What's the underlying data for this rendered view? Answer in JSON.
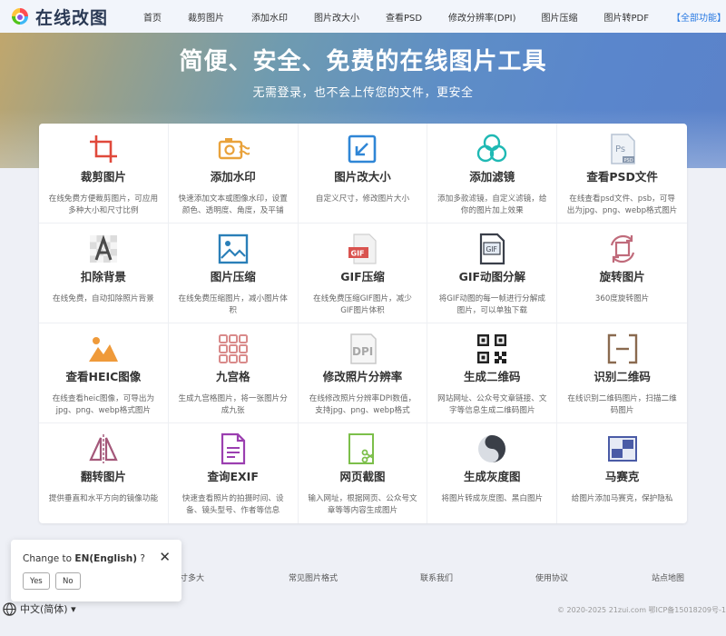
{
  "logo": {
    "text": "在线改图",
    "mark": "rainbow-logo-icon"
  },
  "nav": {
    "items": [
      "首页",
      "裁剪图片",
      "添加水印",
      "图片改大小",
      "查看PSD",
      "修改分辨率(DPI)",
      "图片压缩",
      "图片转PDF",
      "【全部功能】"
    ],
    "accent_color": "#2a7ae2"
  },
  "hero": {
    "title": "简便、安全、免费的在线图片工具",
    "subtitle": "无需登录，也不会上传您的文件，更安全"
  },
  "tools": [
    {
      "name": "裁剪图片",
      "desc": "在线免费方便裁剪图片，可应用多种大小和尺寸比例",
      "icon": "crop-icon"
    },
    {
      "name": "添加水印",
      "desc": "快速添加文本或图像水印，设置颜色、透明度、角度，及平铺",
      "icon": "watermark-icon"
    },
    {
      "name": "图片改大小",
      "desc": "自定义尺寸，修改图片大小",
      "icon": "resize-icon"
    },
    {
      "name": "添加滤镜",
      "desc": "添加多款滤镜，自定义滤镜，给你的图片加上效果",
      "icon": "filter-icon"
    },
    {
      "name": "查看PSD文件",
      "desc": "在线查看psd文件、psb，可导出为jpg、png、webp格式图片",
      "icon": "psd-icon"
    },
    {
      "name": "扣除背景",
      "desc": "在线免费，自动扣除照片背景",
      "icon": "remove-background-icon"
    },
    {
      "name": "图片压缩",
      "desc": "在线免费压缩图片，减小图片体积",
      "icon": "image-compress-icon"
    },
    {
      "name": "GIF压缩",
      "desc": "在线免费压缩GIF图片，减少GIF图片体积",
      "icon": "gif-compress-icon"
    },
    {
      "name": "GIF动图分解",
      "desc": "将GIF动图的每一帧进行分解成图片，可以单独下载",
      "icon": "gif-split-icon"
    },
    {
      "name": "旋转图片",
      "desc": "360度旋转图片",
      "icon": "rotate-icon"
    },
    {
      "name": "查看HEIC图像",
      "desc": "在线查看heic图像，可导出为jpg、png、webp格式图片",
      "icon": "heic-icon"
    },
    {
      "name": "九宫格",
      "desc": "生成九宫格图片，将一张图片分成九张",
      "icon": "nine-grid-icon"
    },
    {
      "name": "修改照片分辨率",
      "desc": "在线修改照片分辨率DPI数值，支持jpg、png、webp格式",
      "icon": "dpi-icon"
    },
    {
      "name": "生成二维码",
      "desc": "网站网址、公众号文章链接、文字等信息生成二维码图片",
      "icon": "qrcode-icon"
    },
    {
      "name": "识别二维码",
      "desc": "在线识别二维码图片，扫描二维码图片",
      "icon": "qr-scan-icon"
    },
    {
      "name": "翻转图片",
      "desc": "提供垂直和水平方向的镜像功能",
      "icon": "flip-icon"
    },
    {
      "name": "查询EXIF",
      "desc": "快速查看照片的拍摄时间、设备、镜头型号、作者等信息",
      "icon": "exif-icon"
    },
    {
      "name": "网页截图",
      "desc": "输入网址，根据网页、公众号文章等等内容生成图片",
      "icon": "web-screenshot-icon"
    },
    {
      "name": "生成灰度图",
      "desc": "将图片转成灰度图、黑白图片",
      "icon": "grayscale-icon"
    },
    {
      "name": "马赛克",
      "desc": "给图片添加马赛克，保护隐私",
      "icon": "mosaic-icon"
    }
  ],
  "footer": {
    "links": [
      "寸多大",
      "常见图片格式",
      "联系我们",
      "使用协议",
      "站点地图"
    ],
    "copyright": "© 2020-2025 21zui.com 鄂ICP备15018209号-1"
  },
  "language": {
    "current": "中文(简体) ▾",
    "icon": "globe-icon"
  },
  "popup": {
    "prefix": "Change to ",
    "language": "EN(English)",
    "suffix": " ?",
    "yes": "Yes",
    "no": "No",
    "close": "✕"
  }
}
